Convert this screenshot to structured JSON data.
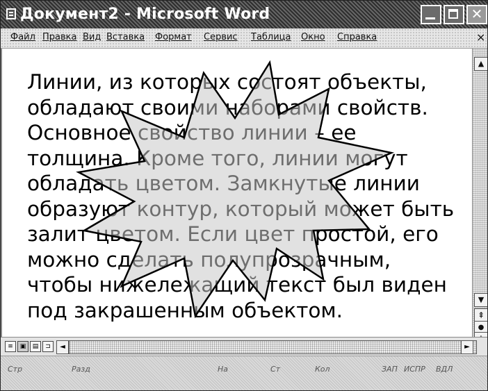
{
  "window": {
    "title": "Документ2 - Microsoft Word",
    "icon": "word-document-icon"
  },
  "menu": {
    "items": [
      "Файл",
      "Правка",
      "Вид",
      "Вставка",
      "Формат",
      "Сервис",
      "Таблица",
      "Окно",
      "Справка"
    ],
    "close_glyph": "×"
  },
  "document": {
    "text": "Линии, из которых состоят объекты,\nобладают своими наборами свойств.\nОсновное свойство линии – ее\nтолщина. Кроме того, линии могут\nобладать цветом. Замкнутые линии\nобразуют контур, который может быть\nзалит цветом. Если цвет простой, его\nможно сделать полупрозрачным,\nчтобы нижележащий текст был виден\nпод закрашенным объектом.",
    "shape": "explosion-star-semi-transparent",
    "shape_fill": "#c8c8c8"
  },
  "scrollbar": {
    "up": "▲",
    "down": "▼",
    "prev_page": "⇞",
    "select_browse": "●",
    "next_page": "⇟"
  },
  "horizontal": {
    "view_buttons": [
      "≡",
      "▣",
      "▤",
      "⊐"
    ],
    "left": "◄",
    "right": "►"
  },
  "statusbar": {
    "items": [
      "Стр",
      "Разд",
      "На",
      "Ст",
      "Кол",
      "ЗАП",
      "ИСПР",
      "ВДЛ"
    ]
  }
}
